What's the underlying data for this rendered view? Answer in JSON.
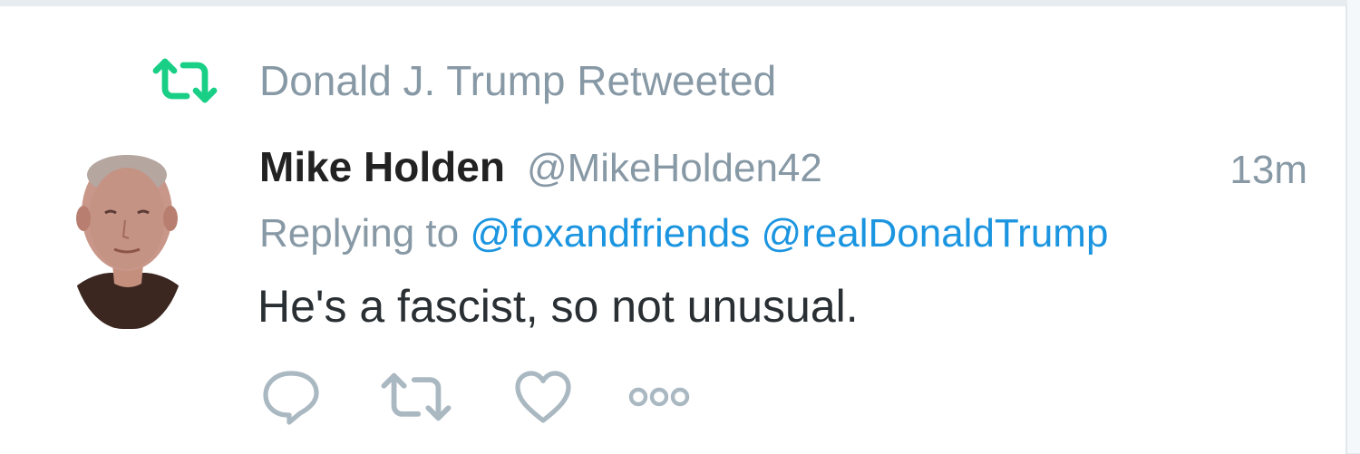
{
  "retweet_context": {
    "icon": "retweet-icon",
    "icon_color": "#19cf86",
    "label": "Donald J. Trump Retweeted"
  },
  "tweet": {
    "author": {
      "fullname": "Mike Holden",
      "username": "@MikeHolden42",
      "avatar": "avatar"
    },
    "timestamp": "13m",
    "replying_to": {
      "prefix": "Replying to",
      "mentions": [
        "@foxandfriends",
        "@realDonaldTrump"
      ]
    },
    "text": "He's a fascist, so not unusual.",
    "actions": [
      {
        "name": "reply",
        "icon": "reply-icon"
      },
      {
        "name": "retweet",
        "icon": "retweet-icon"
      },
      {
        "name": "like",
        "icon": "heart-icon"
      },
      {
        "name": "more",
        "icon": "more-icon"
      }
    ]
  },
  "colors": {
    "secondary_text": "#8899a6",
    "link": "#1b95e0",
    "primary_text": "#292f33",
    "retweet_green": "#19cf86",
    "icon_gray": "#aab8c2"
  }
}
